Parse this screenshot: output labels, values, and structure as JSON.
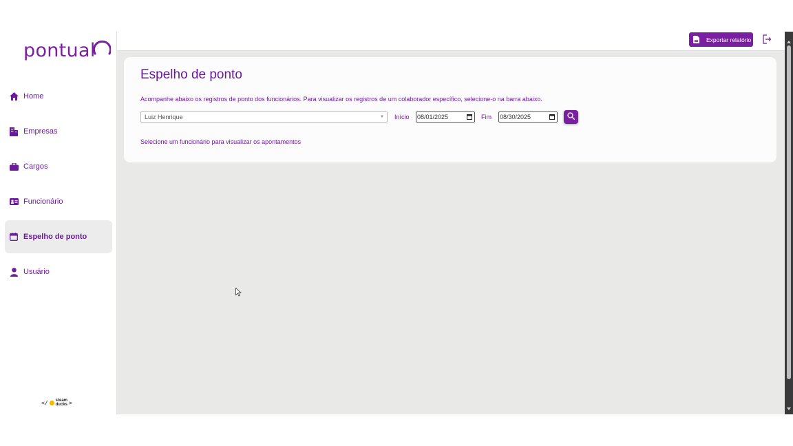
{
  "brand": {
    "name": "pontual",
    "accent": "#7b1fa2"
  },
  "sidebar": {
    "items": [
      {
        "label": "Home",
        "icon": "home-icon",
        "active": false
      },
      {
        "label": "Empresas",
        "icon": "building-icon",
        "active": false
      },
      {
        "label": "Cargos",
        "icon": "briefcase-icon",
        "active": false
      },
      {
        "label": "Funcionário",
        "icon": "id-card-icon",
        "active": false
      },
      {
        "label": "Espelho de ponto",
        "icon": "calendar-icon",
        "active": true
      },
      {
        "label": "Usuário",
        "icon": "user-icon",
        "active": false
      }
    ],
    "footer": {
      "prefix": "</",
      "name_top": "steam",
      "name_bottom": "ducks",
      "suffix": ">"
    }
  },
  "topbar": {
    "export_label": "Exportar relatório",
    "logout_icon": "logout-icon"
  },
  "main": {
    "title": "Espelho de ponto",
    "description": "Acompanhe abaixo os registros de ponto dos funcionários. Para visualizar os registros de um colaborador específico, selecione-o na barra abaixo.",
    "employee_select": {
      "value": "Luiz Henrique"
    },
    "start": {
      "label": "Início",
      "value": "08/01/2025"
    },
    "end": {
      "label": "Fim",
      "value": "08/30/2025"
    },
    "search_icon": "search-icon",
    "hint": "Selecione um funcionário para visualizar os apontamentos"
  }
}
